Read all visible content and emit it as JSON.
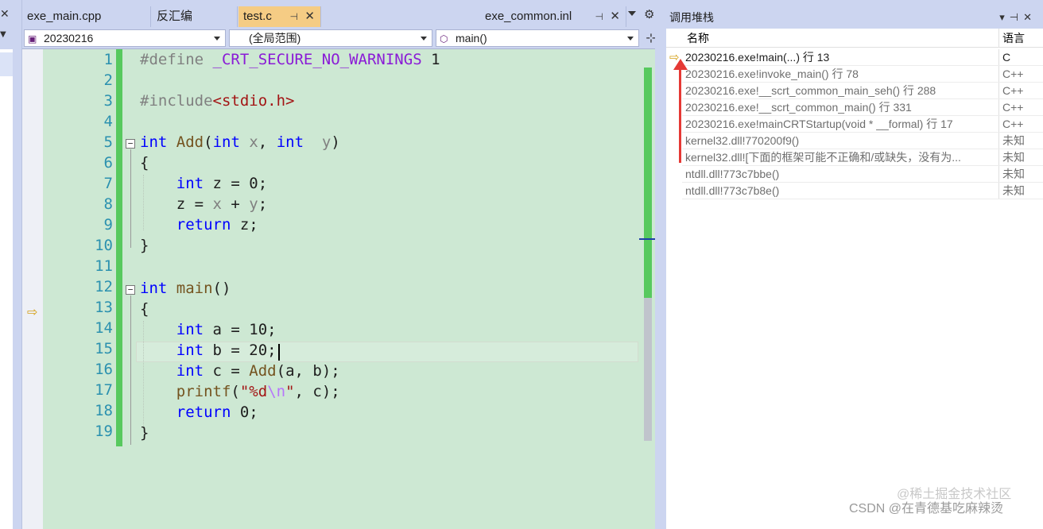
{
  "tabs": [
    {
      "label": "exe_main.cpp"
    },
    {
      "label": "反汇编"
    },
    {
      "label": "test.c",
      "pin": "⊣",
      "close": "✕"
    },
    {
      "label": "exe_common.inl",
      "pin": "⊣",
      "close": "✕"
    }
  ],
  "navbar": {
    "project": "20230216",
    "scope": "(全局范围)",
    "function": "main()"
  },
  "editor": {
    "line_numbers": [
      "1",
      "2",
      "3",
      "4",
      "5",
      "6",
      "7",
      "8",
      "9",
      "10",
      "11",
      "12",
      "13",
      "14",
      "15",
      "16",
      "17",
      "18",
      "19"
    ],
    "current_line": 15,
    "execution_line": 13
  },
  "code_tokens": {
    "l1_define": "#define",
    "l1_macro": "_CRT_SECURE_NO_WARNINGS",
    "l1_val": "1",
    "l3_include": "#include",
    "l3_header": "<stdio.h>",
    "int": "int",
    "return": "return",
    "add": "Add",
    "main": "main",
    "printf": "printf"
  },
  "call_stack": {
    "title": "调用堆栈",
    "col_name": "名称",
    "col_lang": "语言",
    "rows": [
      {
        "name": "20230216.exe!main(...) 行 13",
        "lang": "C"
      },
      {
        "name": "20230216.exe!invoke_main() 行 78",
        "lang": "C++"
      },
      {
        "name": "20230216.exe!__scrt_common_main_seh() 行 288",
        "lang": "C++"
      },
      {
        "name": "20230216.exe!__scrt_common_main() 行 331",
        "lang": "C++"
      },
      {
        "name": "20230216.exe!mainCRTStartup(void * __formal) 行 17",
        "lang": "C++"
      },
      {
        "name": "kernel32.dll!770200f9()",
        "lang": "未知"
      },
      {
        "name": "kernel32.dll![下面的框架可能不正确和/或缺失，没有为...",
        "lang": "未知"
      },
      {
        "name": "ntdll.dll!773c7bbe()",
        "lang": "未知"
      },
      {
        "name": "ntdll.dll!773c7b8e()",
        "lang": "未知"
      }
    ]
  },
  "watermark": "CSDN @在青德基吃麻辣烫",
  "watermark2": "@稀土掘金技术社区",
  "colors": {
    "editor_bg": "#cde8d3",
    "change_bar": "#57c95e",
    "active_tab": "#f5cc84",
    "arrow": "#e53935"
  }
}
